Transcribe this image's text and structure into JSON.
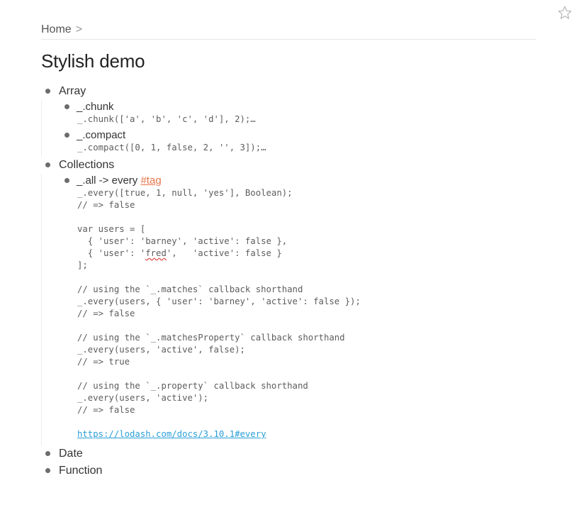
{
  "breadcrumb": {
    "home_label": "Home",
    "separator": ">"
  },
  "page": {
    "title": "Stylish demo"
  },
  "outline": {
    "array": {
      "label": "Array",
      "chunk": {
        "label": "_.chunk",
        "note": "_.chunk(['a', 'b', 'c', 'd'], 2);…"
      },
      "compact": {
        "label": "_.compact",
        "note": "_.compact([0, 1, false, 2, '', 3]);…"
      }
    },
    "collections": {
      "label": "Collections",
      "all": {
        "label": "_.all -> every ",
        "tag": "#tag",
        "code": {
          "l1": "_.every([true, 1, null, 'yes'], Boolean);",
          "l2": "// => false",
          "l3": "var users = [",
          "l4": "  { 'user': 'barney', 'active': false },",
          "l5a": "  { 'user': '",
          "l5b": "fred",
          "l5c": "',   'active': false }",
          "l6": "];",
          "l7": "// using the `_.matches` callback shorthand",
          "l8": "_.every(users, { 'user': 'barney', 'active': false });",
          "l9": "// => false",
          "l10": "// using the `_.matchesProperty` callback shorthand",
          "l11": "_.every(users, 'active', false);",
          "l12": "// => true",
          "l13": "// using the `_.property` callback shorthand",
          "l14": "_.every(users, 'active');",
          "l15": "// => false"
        },
        "link": "https://lodash.com/docs/3.10.1#every"
      }
    },
    "date": {
      "label": "Date"
    },
    "function": {
      "label": "Function"
    }
  },
  "colors": {
    "tag": "#e8754a",
    "link": "#2a9fd8",
    "bullet": "#6c6c6c"
  },
  "icons": {
    "star": "star-outline-icon"
  }
}
